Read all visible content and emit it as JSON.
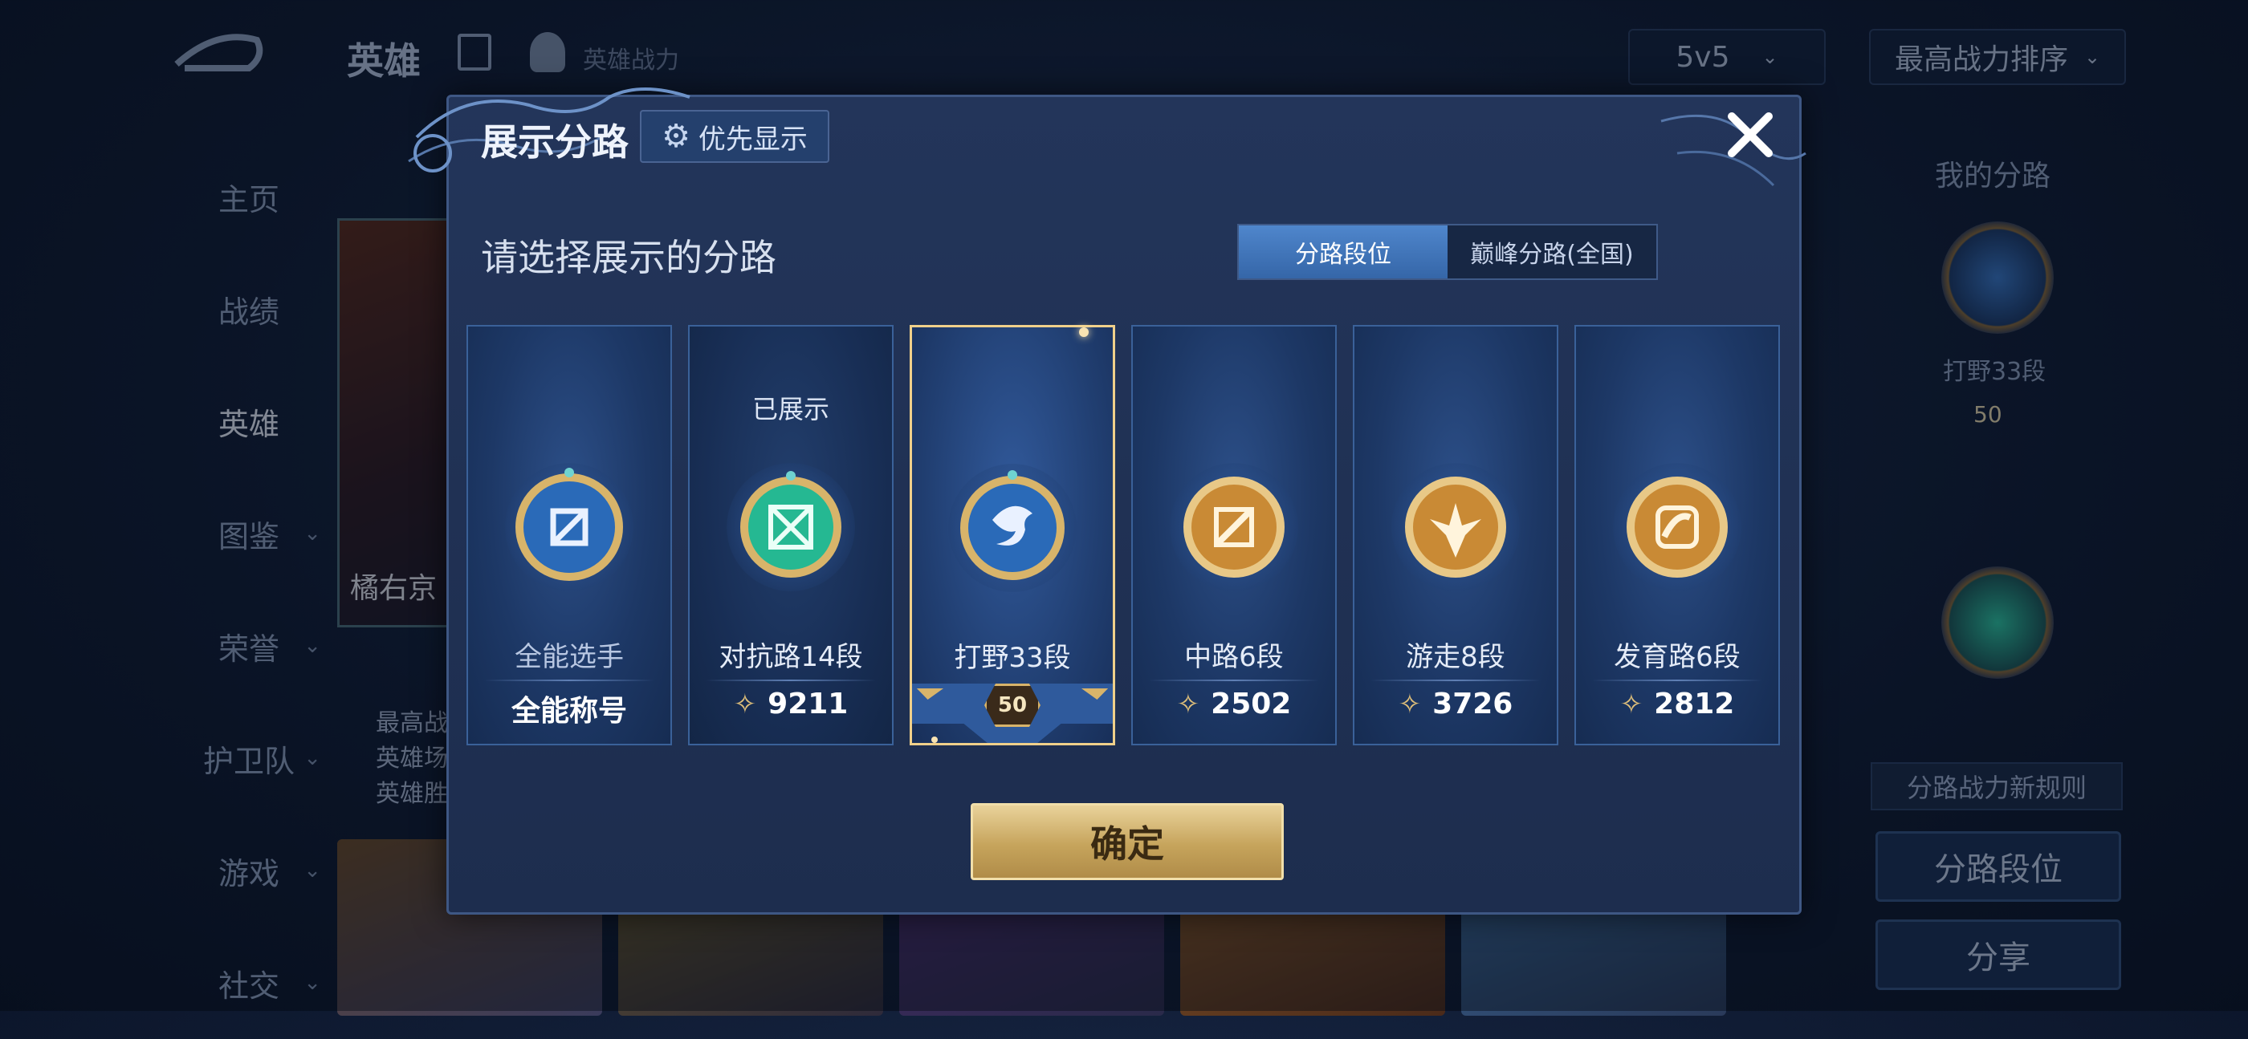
{
  "background": {
    "top_title": "英雄",
    "top_subtitle": "英雄战力",
    "mode_select": "5v5",
    "sort_select": "最高战力排序",
    "nav": [
      "主页",
      "战绩",
      "英雄",
      "图鉴",
      "荣誉",
      "护卫队",
      "游戏",
      "社交"
    ],
    "hero_name": "橘右京",
    "hero_info": [
      "最高战",
      "英雄场",
      "英雄胜"
    ],
    "right_panel": {
      "title": "我的分路",
      "badge_label": "打野33段",
      "badge_level": "50",
      "rule_label": "分路战力新规则",
      "rank_button": "分路段位",
      "share_button": "分享"
    }
  },
  "modal": {
    "title": "展示分路",
    "pref_button": "优先显示",
    "prompt": "请选择展示的分路",
    "tabs": [
      "分路段位",
      "巅峰分路(全国)"
    ],
    "active_tab": 0,
    "cards": [
      {
        "name": "全能选手",
        "tag": "",
        "value": "全能称号",
        "icon": "allround-badge-icon",
        "color": "#3a78c8",
        "state": "allround"
      },
      {
        "name": "对抗路14段",
        "tag": "已展示",
        "value": "9211",
        "icon": "clash-lane-badge-icon",
        "color": "#2ec7a3",
        "state": "muted"
      },
      {
        "name": "打野33段",
        "tag": "",
        "value": "50",
        "icon": "jungle-badge-icon",
        "color": "#3a78c8",
        "state": "selected"
      },
      {
        "name": "中路6段",
        "tag": "",
        "value": "2502",
        "icon": "mid-lane-badge-icon",
        "color": "#d9a54a",
        "state": "normal"
      },
      {
        "name": "游走8段",
        "tag": "",
        "value": "3726",
        "icon": "roam-badge-icon",
        "color": "#d9a54a",
        "state": "normal"
      },
      {
        "name": "发育路6段",
        "tag": "",
        "value": "2812",
        "icon": "farm-lane-badge-icon",
        "color": "#d9a54a",
        "state": "normal"
      }
    ],
    "confirm_button": "确定"
  }
}
